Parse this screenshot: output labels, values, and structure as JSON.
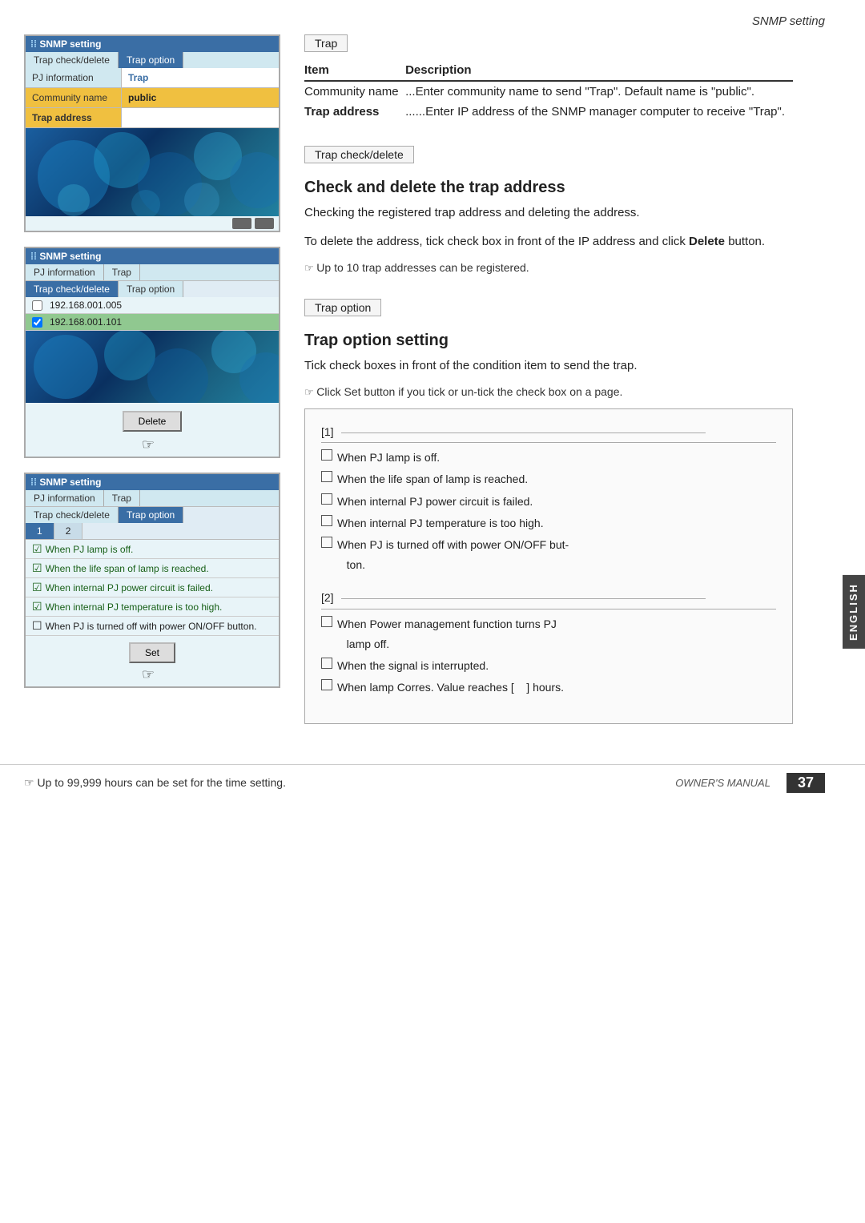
{
  "page": {
    "header": "SNMP setting",
    "footer_note": "Up to 99,999 hours can be set for the time setting.",
    "footer_manual": "OWNER'S MANUAL",
    "page_number": "37",
    "english_label": "ENGLISH"
  },
  "panels": {
    "panel1": {
      "title": "SNMP setting",
      "tabs": [
        "Trap check/delete",
        "Trap option"
      ],
      "active_tab": "Trap option",
      "rows": [
        {
          "label": "PJ information",
          "value": "Trap",
          "value_style": "blue"
        },
        {
          "label": "Community name",
          "value": "public",
          "value_style": "highlighted"
        },
        {
          "label": "Trap address",
          "value": "",
          "value_style": "trap-addr"
        }
      ]
    },
    "panel2": {
      "title": "SNMP setting",
      "tabs": [
        "PJ information",
        "Trap"
      ],
      "active_tab2": "Trap check/delete",
      "active_tab3": "Trap option",
      "checkboxes": [
        {
          "label": "192.168.001.005",
          "checked": false
        },
        {
          "label": "192.168.001.101",
          "checked": true
        }
      ],
      "delete_button": "Delete"
    },
    "panel3": {
      "title": "SNMP setting",
      "tabs": [
        "PJ information",
        "Trap"
      ],
      "active_tab2": "Trap check/delete",
      "active_tab3": "Trap option",
      "number_tabs": [
        "1",
        "2"
      ],
      "checkboxes": [
        {
          "label": "When PJ lamp is off.",
          "checked": true
        },
        {
          "label": "When the life span of lamp is reached.",
          "checked": true
        },
        {
          "label": "When internal PJ power circuit is failed.",
          "checked": true
        },
        {
          "label": "When internal PJ temperature is too high.",
          "checked": true
        },
        {
          "label": "When PJ is turned off with power ON/OFF button.",
          "checked": false
        }
      ],
      "set_button": "Set"
    }
  },
  "trap_section": {
    "box_label": "Trap",
    "table_headers": [
      "Item",
      "Description"
    ],
    "table_rows": [
      {
        "item": "Community name",
        "desc": "...Enter community name to send \"Trap\". Default name is \"public\"."
      },
      {
        "item": "Trap address",
        "desc": "......Enter IP address of the SNMP manager computer to receive \"Trap\"."
      }
    ]
  },
  "trap_check_section": {
    "box_label": "Trap check/delete",
    "title": "Check and delete the trap address",
    "body1": "Checking the registered trap address and deleting the address.",
    "body2": "To delete the address, tick check box in front of the IP address and click",
    "body2_bold": "Delete",
    "body2_end": "button.",
    "note": "Up to 10 trap addresses can be registered."
  },
  "trap_option_section": {
    "box_label": "Trap option",
    "title": "Trap option setting",
    "body1": "Tick check boxes in front of the condition item to send the trap.",
    "note": "Click Set button if you tick or un-tick the check box on a page.",
    "info_box": {
      "section1": {
        "label": "[1]",
        "items": [
          "When PJ lamp is off.",
          "When the life span of lamp is reached.",
          "When internal PJ power circuit is failed.",
          "When internal PJ temperature is too high.",
          "When PJ is turned off with power ON/OFF button."
        ]
      },
      "section2": {
        "label": "[2]",
        "items": [
          "When Power management function turns PJ lamp off.",
          "When the signal is interrupted.",
          "When lamp Corres. Value reaches [    ] hours."
        ]
      }
    }
  }
}
